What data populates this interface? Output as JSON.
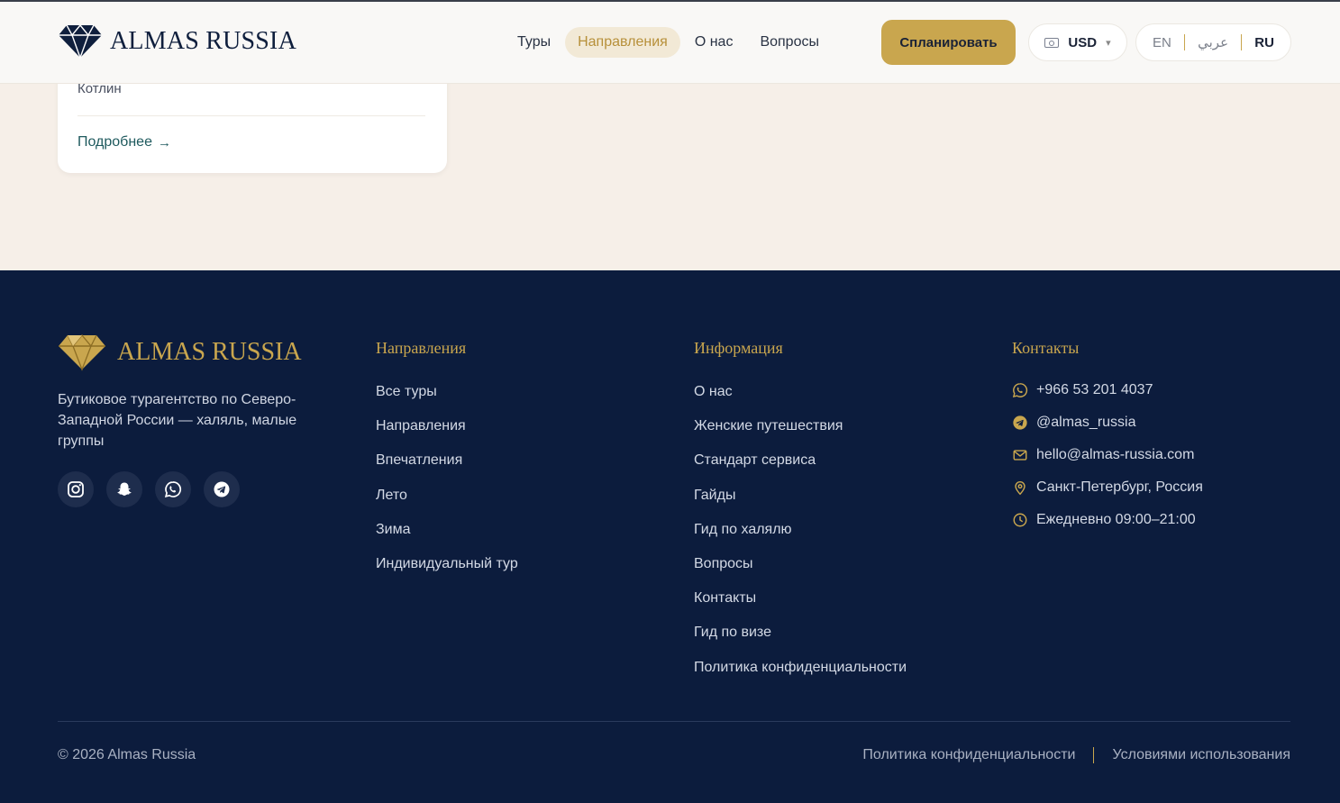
{
  "header": {
    "logo_text": "ALMAS RUSSIA",
    "nav": [
      {
        "label": "Туры",
        "active": false
      },
      {
        "label": "Направления",
        "active": true
      },
      {
        "label": "О нас",
        "active": false
      },
      {
        "label": "Вопросы",
        "active": false
      }
    ],
    "plan_button": "Спланировать",
    "currency": "USD",
    "languages": {
      "en": "EN",
      "ar": "عربي",
      "ru": "RU",
      "selected": "RU"
    }
  },
  "card": {
    "subtitle": "Котлин",
    "link": "Подробнее",
    "link_arrow": "→"
  },
  "footer": {
    "logo_text": "ALMAS RUSSIA",
    "description": "Бутиковое турагентство по Северо-Западной России — халяль, малые группы",
    "socials": [
      "instagram-icon",
      "snapchat-icon",
      "whatsapp-icon",
      "telegram-icon"
    ],
    "directions": {
      "title": "Направления",
      "items": [
        "Все туры",
        "Направления",
        "Впечатления",
        "Лето",
        "Зима",
        "Индивидуальный тур"
      ]
    },
    "info": {
      "title": "Информация",
      "items": [
        "О нас",
        "Женские путешествия",
        "Стандарт сервиса",
        "Гайды",
        "Гид по халялю",
        "Вопросы",
        "Контакты",
        "Гид по визе",
        "Политика конфиденциальности"
      ]
    },
    "contacts": {
      "title": "Контакты",
      "phone": "+966 53 201 4037",
      "telegram": "@almas_russia",
      "email": "hello@almas-russia.com",
      "location": "Санкт-Петербург, Россия",
      "hours": "Ежедневно 09:00–21:00"
    },
    "copyright": "© 2026 Almas Russia",
    "bottom_links": [
      "Политика конфиденциальности",
      "Условиями использования"
    ]
  },
  "colors": {
    "gold": "#c9a64e",
    "navy": "#0c1c3d",
    "page_bg": "#f6efe8",
    "link_teal": "#1f5a5e"
  }
}
